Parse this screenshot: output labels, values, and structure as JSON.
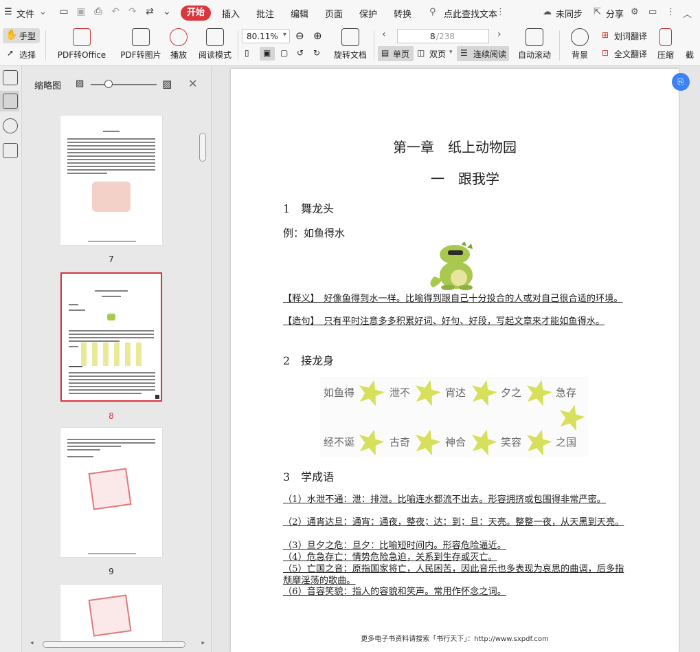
{
  "topbar": {
    "file": "文件",
    "kaishi": "开始",
    "menus": [
      "插入",
      "批注",
      "编辑",
      "页面",
      "保护",
      "转换"
    ],
    "search": "点此查找文本",
    "sync": "未同步",
    "share": "分享"
  },
  "ribbon": {
    "hand": "手型",
    "select": "选择",
    "pdf2office": "PDF转Office",
    "pdf2img": "PDF转图片",
    "play": "播放",
    "read_mode": "阅读模式",
    "zoom": "80.11%",
    "rotate": "旋转文档",
    "page_current": "8",
    "page_total": "/238",
    "single": "单页",
    "double": "双页",
    "continuous": "连续阅读",
    "autoscroll": "自动滚动",
    "background": "背景",
    "word_translate": "划词翻译",
    "full_translate": "全文翻译",
    "compress": "压缩",
    "capture": "截"
  },
  "thumbs": {
    "title": "缩略图",
    "pages": [
      "7",
      "8",
      "9"
    ]
  },
  "page": {
    "chapter": "第一章　纸上动物园",
    "section": "一　跟我学",
    "h1": "1　舞龙头",
    "example": "例：如鱼得水",
    "meaning": "【释义】　好像鱼得到水一样。比喻得到跟自己十分投合的人或对自己很合适的环境。",
    "sentence": "【造句】　只有平时注意多多积累好词、好句、好段，写起文章来才能如鱼得水。",
    "h2": "2　接龙身",
    "chain_row1": [
      "如鱼得",
      "泄不",
      "宵达",
      "夕之",
      "急存"
    ],
    "chain_row2": [
      "经不诞",
      "古奇",
      "神合",
      "笑容",
      "之国"
    ],
    "h3": "3　学成语",
    "idioms": [
      "（1）水泄不通：泄：排泄。比喻连水都流不出去。形容拥挤或包围得非常严密。",
      "（2）通宵达旦：通宵：通夜，整夜；达：到；旦：天亮。整整一夜，从天黑到天亮。",
      "（3）旦夕之危：旦夕：比喻短时间内。形容危险逼近。",
      "（4）危急存亡：情势危险急迫，关系到生存或灭亡。",
      "（5）亡国之音：原指国家将亡，人民困苦，因此音乐也多表现为哀思的曲调，后多指颓靡淫荡的歌曲。",
      "（6）音容笑貌：指人的容貌和笑声。常用作怀念之词。"
    ],
    "footer": "更多电子书资料请搜索「书行天下」：http://www.sxpdf.com"
  },
  "colors": {
    "accent": "#d9363e",
    "star": "#d6e05a",
    "thumb_selected": "#d9363e"
  }
}
